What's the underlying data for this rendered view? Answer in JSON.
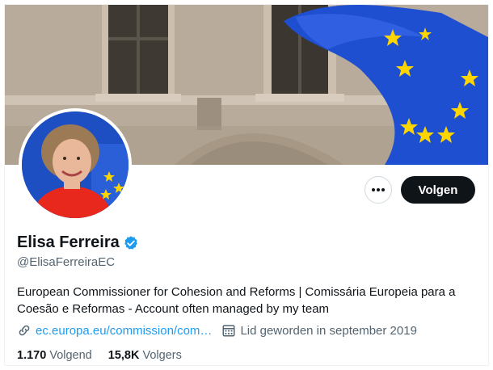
{
  "profile": {
    "name": "Elisa Ferreira",
    "handle": "@ElisaFerreiraEC",
    "bio": "European Commissioner for Cohesion and Reforms | Comissária Europeia para a Coesão e Reformas - Account often managed by my team",
    "link_text": "ec.europa.eu/commission/com…",
    "joined": "Lid geworden in september 2019",
    "verified": true
  },
  "actions": {
    "follow_label": "Volgen",
    "more_icon": "more-horizontal-icon"
  },
  "stats": {
    "following_count": "1.170",
    "following_label": "Volgend",
    "followers_count": "15,8K",
    "followers_label": "Volgers"
  },
  "icons": {
    "verified": "verified-badge-icon",
    "link": "link-icon",
    "calendar": "calendar-icon"
  },
  "colors": {
    "accent": "#1d9bf0",
    "text": "#0f1419",
    "muted": "#536471",
    "button": "#0f1419",
    "eu_blue": "#1f4fd1",
    "eu_star": "#ffd500"
  }
}
